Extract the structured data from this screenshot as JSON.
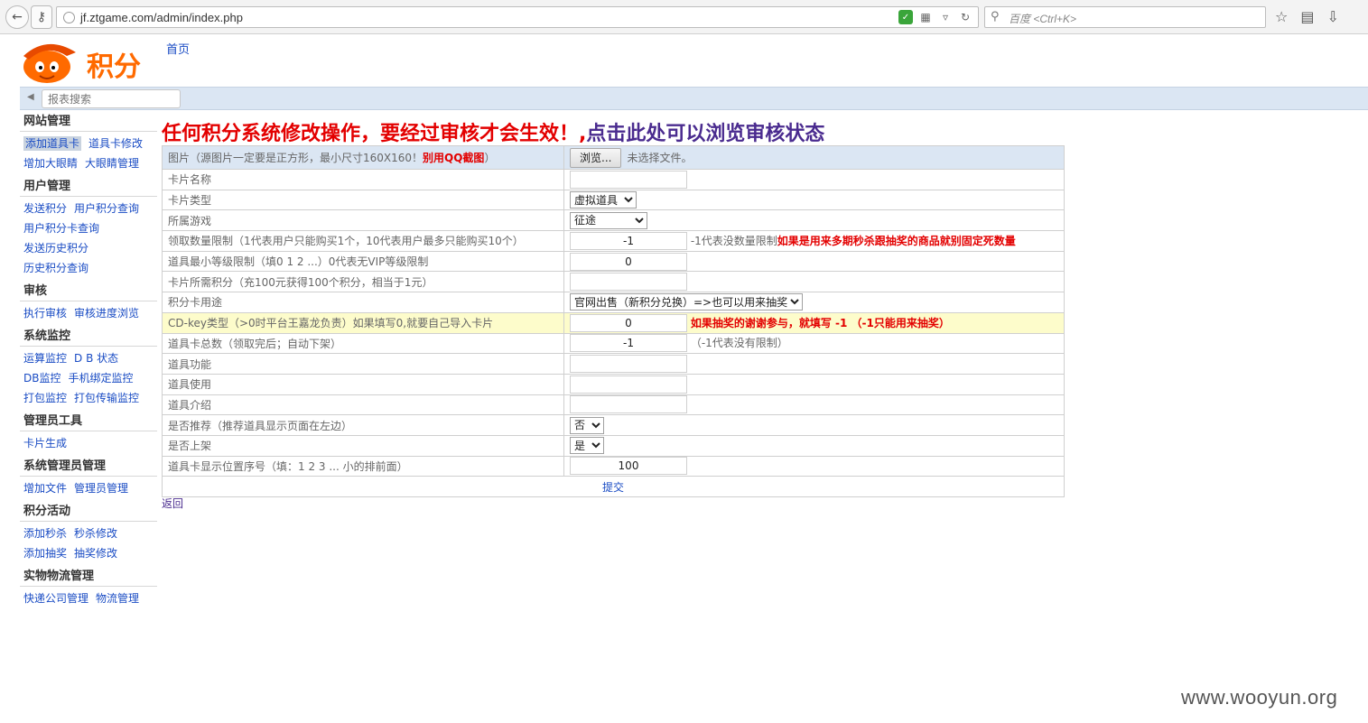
{
  "browser": {
    "url": "jf.ztgame.com/admin/index.php",
    "search_placeholder": "百度 <Ctrl+K>"
  },
  "page": {
    "logo_text": "积分",
    "home_link": "首页",
    "filter_placeholder": "报表搜索",
    "notice_red": "任何积分系统修改操作，要经过审核才会生效！,",
    "notice_purple": "点击此处可以浏览审核状态",
    "back_link": "返回",
    "watermark": "www.wooyun.org"
  },
  "sidebar": [
    {
      "title": "网站管理",
      "rows": [
        [
          "添加道具卡",
          "道具卡修改"
        ],
        [
          "增加大眼睛",
          "大眼睛管理"
        ]
      ]
    },
    {
      "title": "用户管理",
      "rows": [
        [
          "发送积分",
          "用户积分查询"
        ],
        [
          "用户积分卡查询"
        ],
        [
          "发送历史积分"
        ],
        [
          "历史积分查询"
        ]
      ]
    },
    {
      "title": "审核",
      "rows": [
        [
          "执行审核",
          "审核进度浏览"
        ]
      ]
    },
    {
      "title": "系统监控",
      "rows": [
        [
          "运算监控",
          "D B 状态"
        ],
        [
          "DB监控",
          "手机绑定监控"
        ],
        [
          "打包监控",
          "打包传输监控"
        ]
      ]
    },
    {
      "title": "管理员工具",
      "rows": [
        [
          "卡片生成"
        ]
      ]
    },
    {
      "title": "系统管理员管理",
      "rows": [
        [
          "增加文件",
          "管理员管理"
        ]
      ]
    },
    {
      "title": "积分活动",
      "rows": [
        [
          "添加秒杀",
          "秒杀修改"
        ],
        [
          "添加抽奖",
          "抽奖修改"
        ]
      ]
    },
    {
      "title": "实物物流管理",
      "rows": [
        [
          "快递公司管理",
          "物流管理"
        ]
      ]
    }
  ],
  "form": {
    "image_label": "图片（源图片一定要是正方形，最小尺寸160X160！",
    "image_label_red": "别用QQ截图",
    "image_label_end": "）",
    "browse_button": "浏览...",
    "no_file": "未选择文件。",
    "card_name_label": "卡片名称",
    "card_type_label": "卡片类型",
    "card_type_value": "虚拟道具",
    "game_label": "所属游戏",
    "game_value": "征途",
    "limit_label": "领取数量限制（1代表用户只能购买1个，10代表用户最多只能购买10个）",
    "limit_value": "-1",
    "limit_hint": "-1代表没数量限制",
    "limit_hint_red": "如果是用来多期秒杀跟抽奖的商品就别固定死数量",
    "level_label": "道具最小等级限制（填0 1 2 ...）0代表无VIP等级限制",
    "level_value": "0",
    "points_label": "卡片所需积分（充100元获得100个积分，相当于1元）",
    "points_value": "",
    "usage_label": "积分卡用途",
    "usage_value": "官网出售（新积分兑换）=>也可以用来抽奖",
    "cdkey_label": "CD-key类型（>0时平台王嘉龙负责）如果填写0,就要自己导入卡片",
    "cdkey_value": "0",
    "cdkey_hint_red": "如果抽奖的谢谢参与，就填写 -1 （-1只能用来抽奖）",
    "total_label": "道具卡总数（领取完后；自动下架）",
    "total_value": "-1",
    "total_hint": "（-1代表没有限制）",
    "function_label": "道具功能",
    "use_label": "道具使用",
    "intro_label": "道具介绍",
    "recommend_label": "是否推荐（推荐道具显示页面在左边）",
    "recommend_value": "否",
    "onshelf_label": "是否上架",
    "onshelf_value": "是",
    "order_label": "道具卡显示位置序号（填：1 2 3 ... 小的排前面）",
    "order_value": "100",
    "submit": "提交"
  }
}
